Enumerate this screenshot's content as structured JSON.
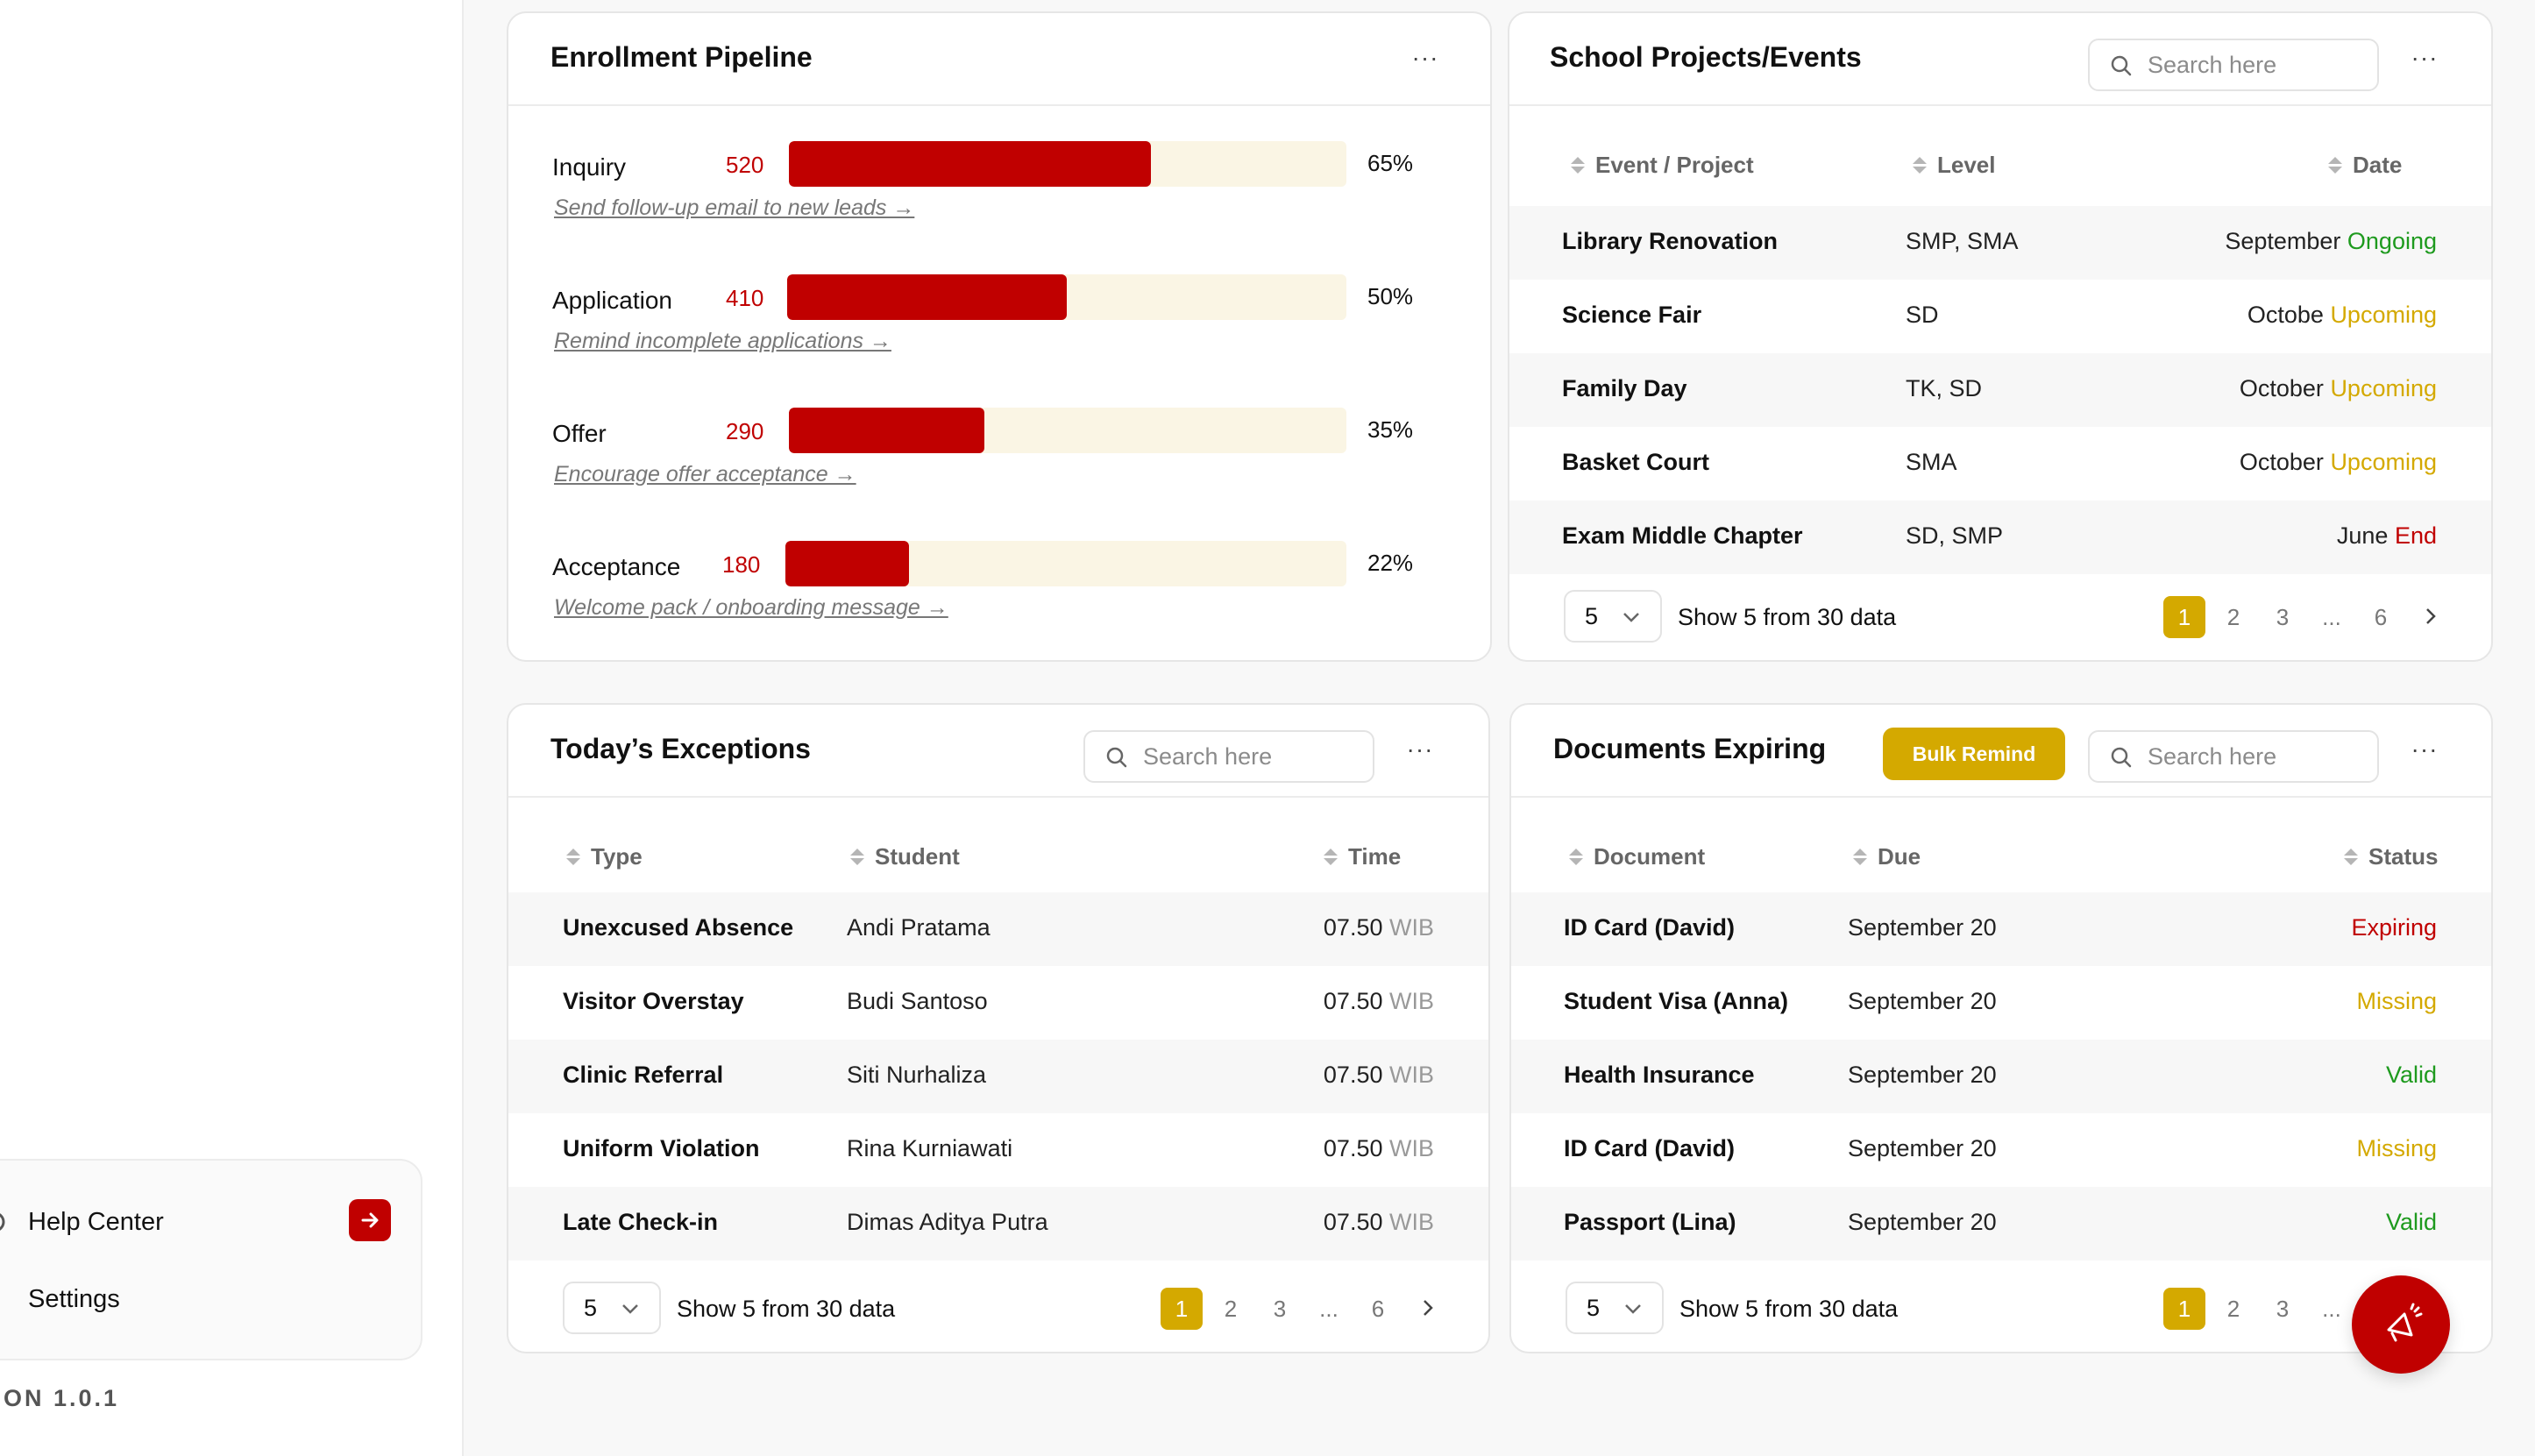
{
  "sidebar": {
    "help_label": "Help Center",
    "settings_label": "Settings",
    "version": "ON 1.0.1"
  },
  "pipeline": {
    "title": "Enrollment Pipeline",
    "more": "···",
    "stages": [
      {
        "label": "Inquiry",
        "count": "520",
        "percent": "65%",
        "fill": 0.65,
        "link": "Send follow-up email to new leads →"
      },
      {
        "label": "Application",
        "count": "410",
        "percent": "50%",
        "fill": 0.5,
        "link": "Remind incomplete applications →"
      },
      {
        "label": "Offer",
        "count": "290",
        "percent": "35%",
        "fill": 0.35,
        "link": "Encourage offer acceptance →"
      },
      {
        "label": "Acceptance",
        "count": "180",
        "percent": "22%",
        "fill": 0.22,
        "link": "Welcome pack / onboarding message →"
      }
    ]
  },
  "projects": {
    "title": "School Projects/Events",
    "search_placeholder": "Search here",
    "more": "···",
    "columns": [
      "Event / Project",
      "Level",
      "Date"
    ],
    "rows": [
      {
        "name": "Library Renovation",
        "level": "SMP, SMA",
        "month": "September",
        "status": "Ongoing",
        "status_color": "#1e9a1e"
      },
      {
        "name": "Science Fair",
        "level": "SD",
        "month": "Octobe",
        "status": "Upcoming",
        "status_color": "#d4a900"
      },
      {
        "name": "Family Day",
        "level": "TK, SD",
        "month": "October",
        "status": "Upcoming",
        "status_color": "#d4a900"
      },
      {
        "name": "Basket Court",
        "level": "SMA",
        "month": "October",
        "status": "Upcoming",
        "status_color": "#d4a900"
      },
      {
        "name": "Exam Middle Chapter",
        "level": "SD, SMP",
        "month": "June",
        "status": "End",
        "status_color": "#c00000"
      }
    ],
    "pager": {
      "size": "5",
      "summary": "Show 5 from 30 data",
      "pages": [
        "1",
        "2",
        "3",
        "...",
        "6"
      ]
    }
  },
  "exceptions": {
    "title": "Today’s Exceptions",
    "search_placeholder": "Search here",
    "more": "···",
    "columns": [
      "Type",
      "Student",
      "Time"
    ],
    "rows": [
      {
        "type": "Unexcused Absence",
        "student": "Andi Pratama",
        "time": "07.50",
        "zone": "WIB"
      },
      {
        "type": "Visitor Overstay",
        "student": "Budi Santoso",
        "time": "07.50",
        "zone": "WIB"
      },
      {
        "type": "Clinic Referral",
        "student": "Siti Nurhaliza",
        "time": "07.50",
        "zone": "WIB"
      },
      {
        "type": "Uniform Violation",
        "student": "Rina Kurniawati",
        "time": "07.50",
        "zone": "WIB"
      },
      {
        "type": "Late Check-in",
        "student": "Dimas Aditya Putra",
        "time": "07.50",
        "zone": "WIB"
      }
    ],
    "pager": {
      "size": "5",
      "summary": "Show 5 from 30 data",
      "pages": [
        "1",
        "2",
        "3",
        "...",
        "6"
      ]
    }
  },
  "documents": {
    "title": "Documents Expiring",
    "bulk_label": "Bulk Remind",
    "search_placeholder": "Search here",
    "more": "···",
    "columns": [
      "Document",
      "Due",
      "Status"
    ],
    "rows": [
      {
        "doc": "ID Card (David)",
        "due": "September 20",
        "status": "Expiring",
        "status_color": "#c00000"
      },
      {
        "doc": "Student Visa (Anna)",
        "due": "September 20",
        "status": "Missing",
        "status_color": "#d4a900"
      },
      {
        "doc": "Health Insurance",
        "due": "September 20",
        "status": "Valid",
        "status_color": "#1e9a1e"
      },
      {
        "doc": "ID Card (David)",
        "due": "September 20",
        "status": "Missing",
        "status_color": "#d4a900"
      },
      {
        "doc": "Passport (Lina)",
        "due": "September 20",
        "status": "Valid",
        "status_color": "#1e9a1e"
      }
    ],
    "pager": {
      "size": "5",
      "summary": "Show 5 from 30 data",
      "pages": [
        "1",
        "2",
        "3",
        "..."
      ]
    }
  },
  "colors": {
    "brand_red": "#c00000",
    "accent_gold": "#d4a900",
    "track": "#faf5e4"
  }
}
